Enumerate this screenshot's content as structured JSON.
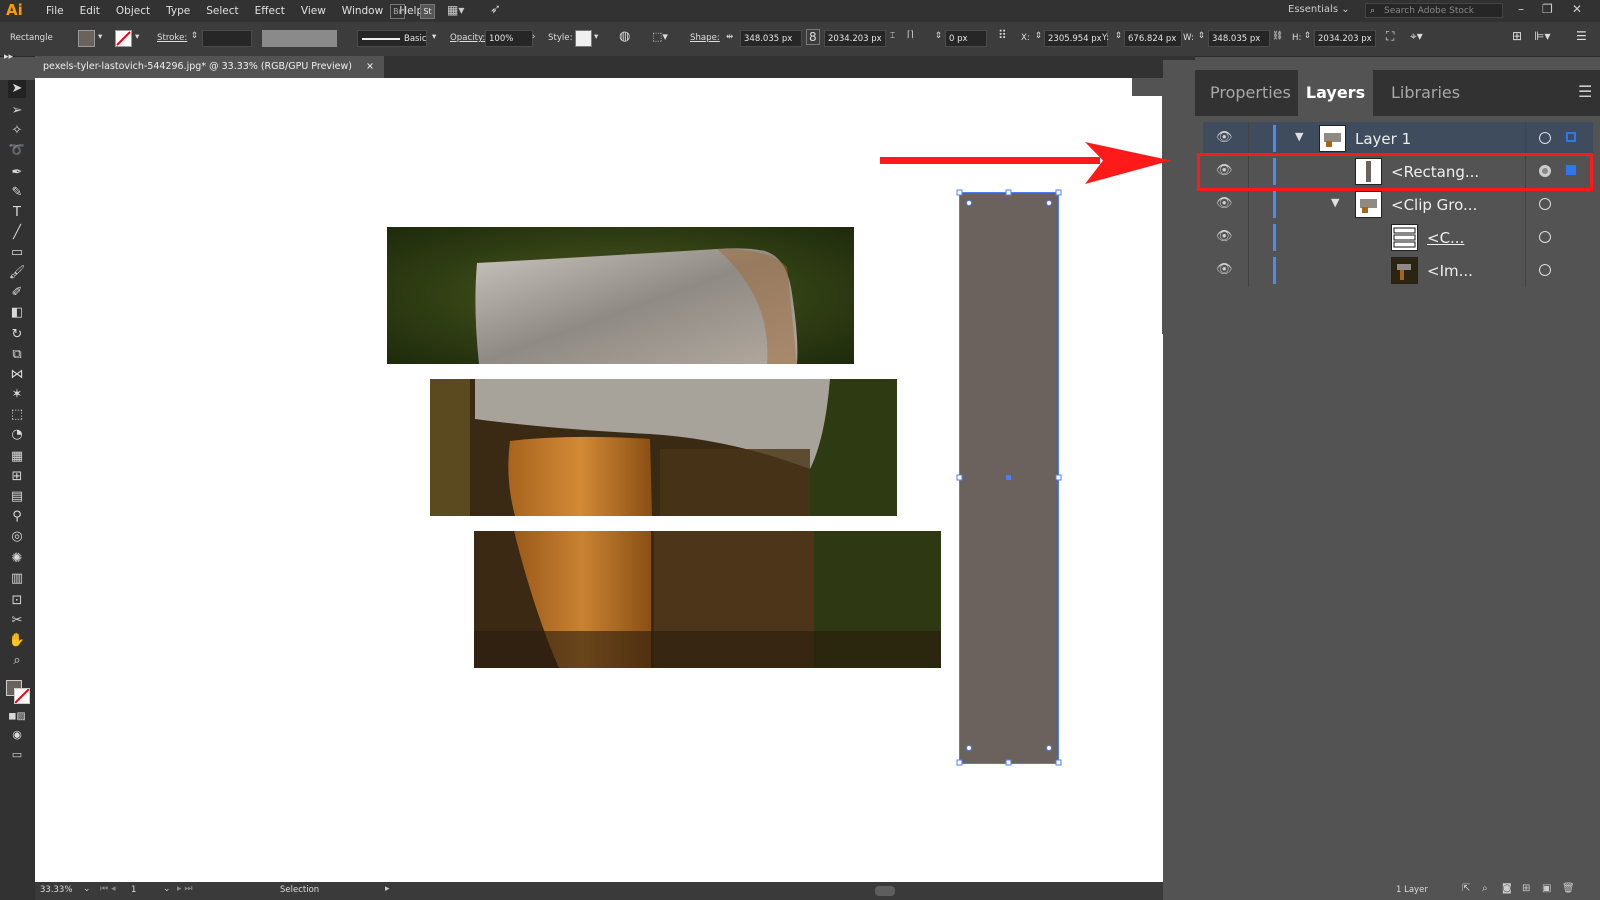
{
  "menubar": {
    "logo": "Ai",
    "items": [
      "File",
      "Edit",
      "Object",
      "Type",
      "Select",
      "Effect",
      "View",
      "Window",
      "Help"
    ],
    "workspace": "Essentials",
    "search_placeholder": "Search Adobe Stock"
  },
  "control": {
    "object_type": "Rectangle",
    "stroke_label": "Stroke:",
    "brush_label": "Basic",
    "opacity_label": "Opacity:",
    "opacity_value": "100%",
    "style_label": "Style:",
    "shape_label": "Shape:",
    "shape_w": "348.035 px",
    "shape_h": "2034.203 px",
    "corner": "0 px",
    "x_label": "X:",
    "x_value": "2305.954 px",
    "y_label": "Y:",
    "y_value": "676.824 px",
    "w_label": "W:",
    "w_value": "348.035 px",
    "h_label": "H:",
    "h_value": "2034.203 px",
    "fill_color": "#6b625d"
  },
  "document": {
    "tab_title": "pexels-tyler-lastovich-544296.jpg* @ 33.33% (RGB/GPU Preview)",
    "close": "×"
  },
  "statusbar": {
    "zoom": "33.33%",
    "artboard": "1",
    "tool": "Selection",
    "layers_count": "1 Layer"
  },
  "panel": {
    "tabs": [
      "Properties",
      "Layers",
      "Libraries"
    ],
    "active_tab": "Layers",
    "layers": [
      {
        "name": "Layer 1",
        "indent": 0,
        "expanded": true
      },
      {
        "name": "<Rectang...",
        "indent": 1,
        "selected": true
      },
      {
        "name": "<Clip Gro...",
        "indent": 1,
        "expanded": true
      },
      {
        "name": "<C...",
        "indent": 2
      },
      {
        "name": "<Im...",
        "indent": 2
      }
    ]
  },
  "colors": {
    "accent": "#2d77f3",
    "annotation": "#ff1a1a",
    "rect_fill": "#6b625d"
  }
}
